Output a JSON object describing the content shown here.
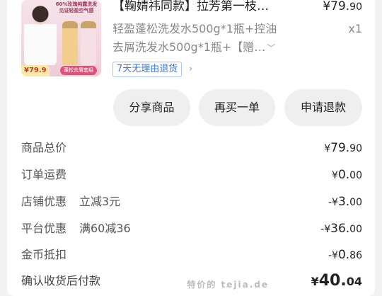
{
  "product": {
    "title": "【鞠婧祎同款】拉芳第一枝…",
    "price_int": "¥79.",
    "price_cents": "90",
    "spec_line1": "轻盈蓬松洗发水500g*1瓶+控油",
    "spec_line2": "去屑洗发水500g*1瓶+【赠…",
    "qty": "x1",
    "refund_tag": "7天无理由退货",
    "thumb_tag_price": "79.9",
    "thumb_tag_promo": "蓬松去屑套组",
    "thumb_text": "60%玫瑰纯露洗发 见证轻盈空气感"
  },
  "actions": {
    "share": "分享商品",
    "rebuy": "再买一单",
    "refund": "申请退款"
  },
  "summary": {
    "goods_total": {
      "label": "商品总价",
      "cur": "¥",
      "int": "79.",
      "cents": "90"
    },
    "shipping": {
      "label": "订单运费",
      "cur": "¥",
      "int": "0.",
      "cents": "00"
    },
    "shop_discount": {
      "label": "店铺优惠",
      "sub": "立减3元",
      "cur": "-¥",
      "int": "3.",
      "cents": "00"
    },
    "platform_discount": {
      "label": "平台优惠",
      "sub": "满60减36",
      "cur": "-¥",
      "int": "36.",
      "cents": "00"
    },
    "coin_deduct": {
      "label": "金币抵扣",
      "cur": "-¥",
      "int": "0.",
      "cents": "86"
    },
    "final": {
      "label": "确认收货后付款",
      "cur": "¥",
      "int": "40.",
      "cents": "04"
    }
  },
  "watermark": "特价的 tejia.de"
}
